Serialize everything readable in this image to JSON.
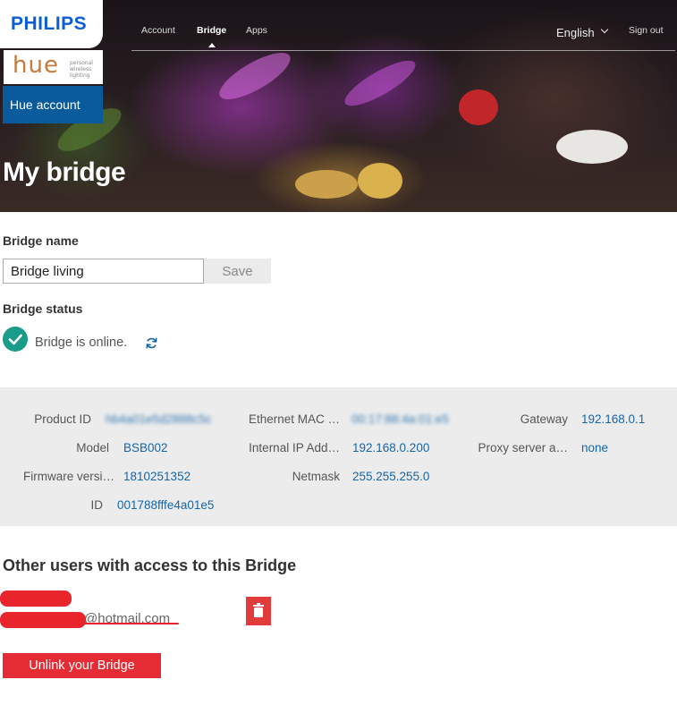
{
  "brand": {
    "logo": "PHILIPS",
    "hue_logo": "hue",
    "hue_tagline": "personal wireless lighting",
    "account_button": "Hue account"
  },
  "nav": {
    "items": [
      {
        "label": "Account"
      },
      {
        "label": "Bridge"
      },
      {
        "label": "Apps"
      }
    ],
    "active": "Bridge",
    "language": "English",
    "sign_out": "Sign out"
  },
  "page_title": "My bridge",
  "bridge_name": {
    "label": "Bridge name",
    "value": "Bridge living",
    "save_label": "Save"
  },
  "bridge_status": {
    "label": "Bridge status",
    "text": "Bridge is online."
  },
  "info": {
    "product_id": {
      "label": "Product ID",
      "value": "hb4a01e5d2888c5c"
    },
    "model": {
      "label": "Model",
      "value": "BSB002"
    },
    "firmware": {
      "label": "Firmware versi…",
      "value": "1810251352"
    },
    "id": {
      "label": "ID",
      "value": "001788fffe4a01e5"
    },
    "ethernet_mac": {
      "label": "Ethernet MAC …",
      "value": "00:17:88:4a:01:e5"
    },
    "internal_ip": {
      "label": "Internal IP Add…",
      "value": "192.168.0.200"
    },
    "netmask": {
      "label": "Netmask",
      "value": "255.255.255.0"
    },
    "gateway": {
      "label": "Gateway",
      "value": "192.168.0.1"
    },
    "proxy": {
      "label": "Proxy server a…",
      "value": "none"
    }
  },
  "other_users": {
    "heading": "Other users with access to this Bridge",
    "users": [
      {
        "email": "@hotmail.com"
      }
    ]
  },
  "unlink_label": "Unlink your Bridge",
  "colors": {
    "philips_blue": "#0b5ed7",
    "account_blue": "#0a5b9b",
    "status_green": "#1a9c8a",
    "link_blue": "#1565a8",
    "danger_red": "#e52b34",
    "panel_gray": "#ececec"
  }
}
